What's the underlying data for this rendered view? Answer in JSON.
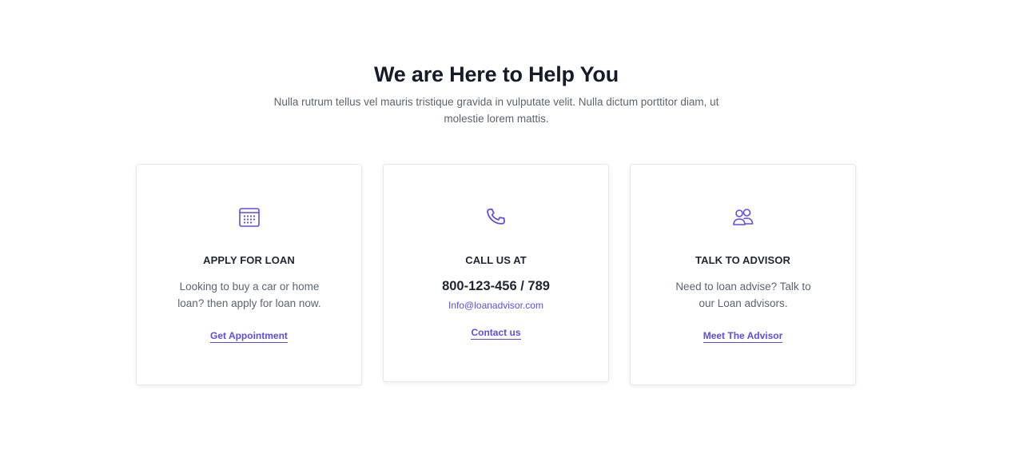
{
  "section": {
    "heading": "We are Here to Help You",
    "subtitle": "Nulla rutrum tellus vel mauris tristique gravida in vulputate velit. Nulla dictum porttitor diam, ut molestie lorem mattis."
  },
  "colors": {
    "accent": "#5b4ee8",
    "heading": "#141c2b",
    "body_text": "#5b6473",
    "card_border": "#e6e8ee"
  },
  "cards": [
    {
      "icon": "calendar-icon",
      "title": "APPLY FOR LOAN",
      "text": "Looking to buy a car or home loan? then apply for loan now.",
      "link": "Get Appointment"
    },
    {
      "icon": "phone-icon",
      "title": "CALL US AT",
      "phone": "800-123-456 / 789",
      "email": "Info@loanadvisor.com",
      "link": "Contact us"
    },
    {
      "icon": "users-icon",
      "title": "TALK TO ADVISOR",
      "text": "Need to loan advise? Talk to our Loan advisors.",
      "link": "Meet The Advisor"
    }
  ]
}
